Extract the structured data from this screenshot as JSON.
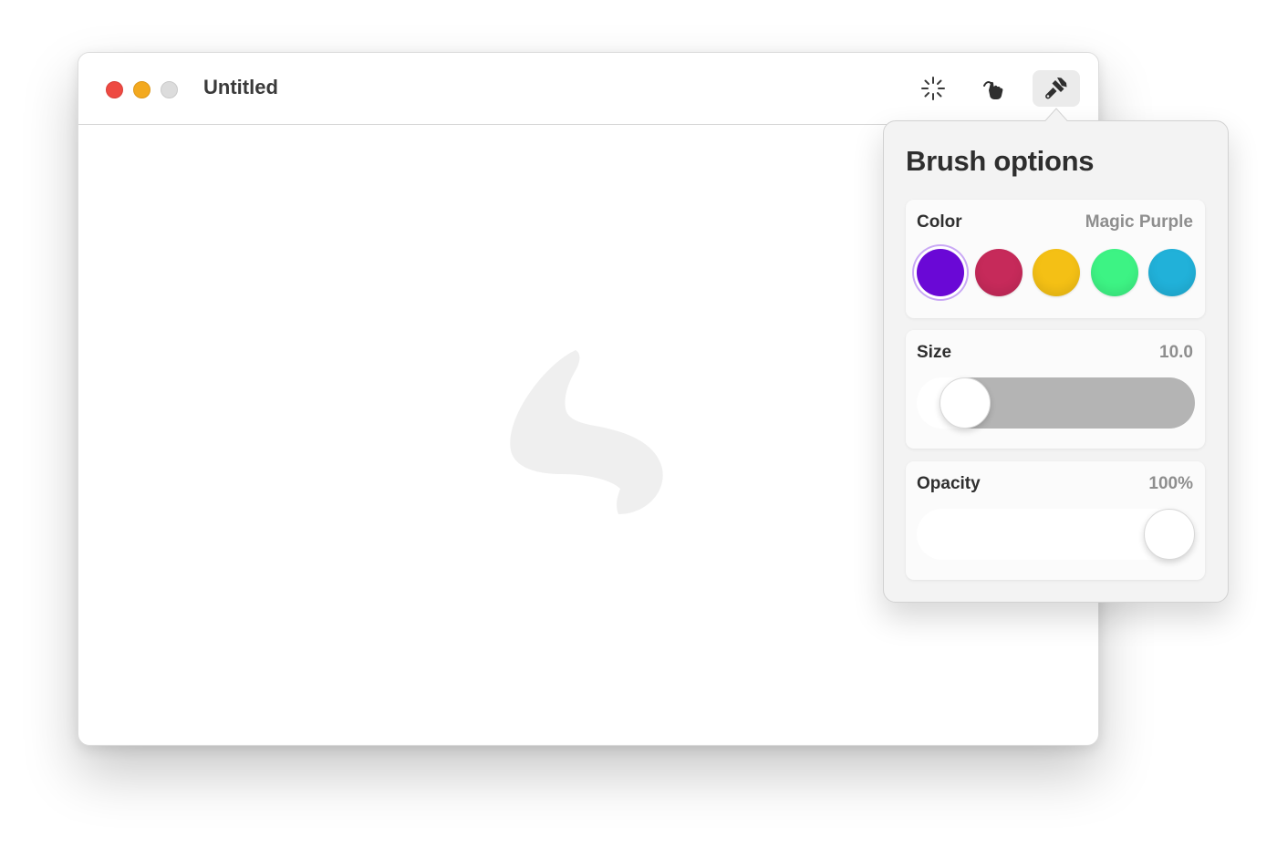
{
  "window": {
    "title": "Untitled"
  },
  "toolbar": {
    "tools": [
      {
        "icon": "sparkle-icon",
        "selected": false
      },
      {
        "icon": "hand-pointer-icon",
        "selected": false
      },
      {
        "icon": "brush-icon",
        "selected": true
      }
    ]
  },
  "canvas": {
    "placeholder_icon": "app-logo-icon"
  },
  "brush_options": {
    "title": "Brush options",
    "color": {
      "label": "Color",
      "value": "Magic Purple",
      "swatches": [
        {
          "name": "Magic Purple",
          "hex": "#6a08d6",
          "selected": true
        },
        {
          "hex": "#c62a5a",
          "selected": false
        },
        {
          "hex": "#f4c015",
          "selected": false
        },
        {
          "hex": "#3df384",
          "selected": false
        },
        {
          "hex": "#21b1d9",
          "selected": false
        }
      ]
    },
    "size": {
      "label": "Size",
      "value": "10.0",
      "fraction": 0.1
    },
    "opacity": {
      "label": "Opacity",
      "value": "100%",
      "fraction": 1.0
    }
  },
  "colors": {
    "track_fill_gray": "#b4b4b4"
  }
}
